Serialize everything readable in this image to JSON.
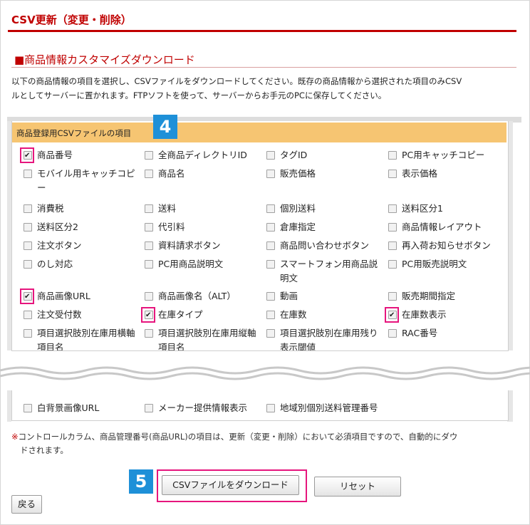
{
  "page_title": "CSV更新（変更・削除）",
  "section_title": "■商品情報カスタマイズダウンロード",
  "description": [
    "以下の商品情報の項目を選択し、CSVファイルをダウンロードしてください。既存の商品情報から選択された項目のみCSV",
    "ルとしてサーバーに置かれます。FTPソフトを使って、サーバーからお手元のPCに保存してください。"
  ],
  "panel_header": "商品登録用CSVファイルの項目",
  "badges": {
    "step4": "4",
    "step5": "5"
  },
  "items": [
    {
      "label": "商品番号",
      "checked": true
    },
    {
      "label": "全商品ディレクトリID",
      "checked": false
    },
    {
      "label": "タグID",
      "checked": false
    },
    {
      "label": "PC用キャッチコピー",
      "checked": false
    },
    {
      "label": "モバイル用キャッチコピ",
      "label2": "ー",
      "checked": false
    },
    {
      "label": "商品名",
      "checked": false
    },
    {
      "label": "販売価格",
      "checked": false
    },
    {
      "label": "表示価格",
      "checked": false
    },
    {
      "label": "消費税",
      "checked": false
    },
    {
      "label": "送料",
      "checked": false
    },
    {
      "label": "個別送料",
      "checked": false
    },
    {
      "label": "送料区分1",
      "checked": false
    },
    {
      "label": "送料区分2",
      "checked": false
    },
    {
      "label": "代引料",
      "checked": false
    },
    {
      "label": "倉庫指定",
      "checked": false
    },
    {
      "label": "商品情報レイアウト",
      "checked": false
    },
    {
      "label": "注文ボタン",
      "checked": false
    },
    {
      "label": "資料請求ボタン",
      "checked": false
    },
    {
      "label": "商品問い合わせボタン",
      "checked": false
    },
    {
      "label": "再入荷お知らせボタン",
      "checked": false
    },
    {
      "label": "のし対応",
      "checked": false
    },
    {
      "label": "PC用商品説明文",
      "checked": false
    },
    {
      "label": "スマートフォン用商品説",
      "label2": "明文",
      "checked": false
    },
    {
      "label": "PC用販売説明文",
      "checked": false
    },
    {
      "label": "商品画像URL",
      "checked": true
    },
    {
      "label": "商品画像名（ALT）",
      "checked": false
    },
    {
      "label": "動画",
      "checked": false
    },
    {
      "label": "販売期間指定",
      "checked": false
    },
    {
      "label": "注文受付数",
      "checked": false
    },
    {
      "label": "在庫タイプ",
      "checked": true
    },
    {
      "label": "在庫数",
      "checked": false
    },
    {
      "label": "在庫数表示",
      "checked": true
    },
    {
      "label": "項目選択肢別在庫用横軸",
      "label2": "項目名",
      "checked": false
    },
    {
      "label": "項目選択肢別在庫用縦軸",
      "label2": "項目名",
      "checked": false
    },
    {
      "label": "項目選択肢別在庫用残り",
      "label2": "表示閾値",
      "checked": false
    },
    {
      "label": "RAC番号",
      "checked": false
    }
  ],
  "lower_items": [
    {
      "label": "白背景画像URL",
      "checked": false
    },
    {
      "label": "メーカー提供情報表示",
      "checked": false
    },
    {
      "label": "地域別個別送料管理番号",
      "checked": false
    }
  ],
  "note": {
    "mark": "※",
    "line1": "コントロールカラム、商品管理番号(商品URL)の項目は、更新（変更・削除）において必須項目ですので、自動的にダウ",
    "line2": "ドされます。"
  },
  "buttons": {
    "download": "CSVファイルをダウンロード",
    "reset": "リセット",
    "back": "戻る"
  },
  "colors": {
    "accent_red": "#c00000",
    "highlight_pink": "#e6157d",
    "badge_blue": "#1e90d8",
    "header_orange": "#f6c572"
  }
}
